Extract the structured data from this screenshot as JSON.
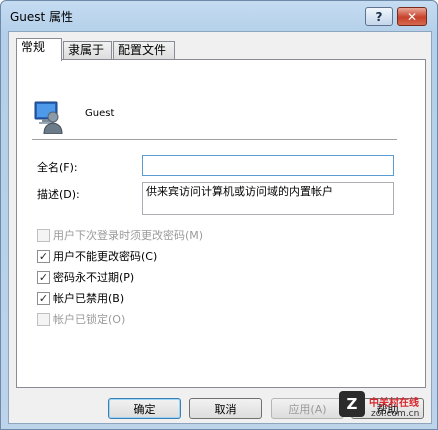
{
  "window": {
    "title": "Guest 属性"
  },
  "titlebar": {
    "help_label": "?",
    "close_label": "✕"
  },
  "tabs": [
    {
      "label": "常规"
    },
    {
      "label": "隶属于"
    },
    {
      "label": "配置文件"
    }
  ],
  "user": {
    "name": "Guest",
    "icon": "user-account-icon"
  },
  "fields": {
    "fullname": {
      "label": "全名(F):",
      "value": ""
    },
    "description": {
      "label": "描述(D):",
      "value": "供来宾访问计算机或访问域的内置帐户"
    }
  },
  "options": [
    {
      "label": "用户下次登录时须更改密码(M)",
      "checked": false,
      "enabled": false
    },
    {
      "label": "用户不能更改密码(C)",
      "checked": true,
      "enabled": true
    },
    {
      "label": "密码永不过期(P)",
      "checked": true,
      "enabled": true
    },
    {
      "label": "帐户已禁用(B)",
      "checked": true,
      "enabled": true
    },
    {
      "label": "帐户已锁定(O)",
      "checked": false,
      "enabled": false
    }
  ],
  "buttons": {
    "ok": "确定",
    "cancel": "取消",
    "apply": "应用(A)",
    "help": "帮助"
  },
  "watermark": {
    "logo": "Z",
    "site_cn": "中关村在线",
    "url": "zol.com.cn"
  },
  "colors": {
    "title_bar": "#b3cfe9",
    "close_button": "#c7412a",
    "focus_border": "#5c9bd1"
  }
}
